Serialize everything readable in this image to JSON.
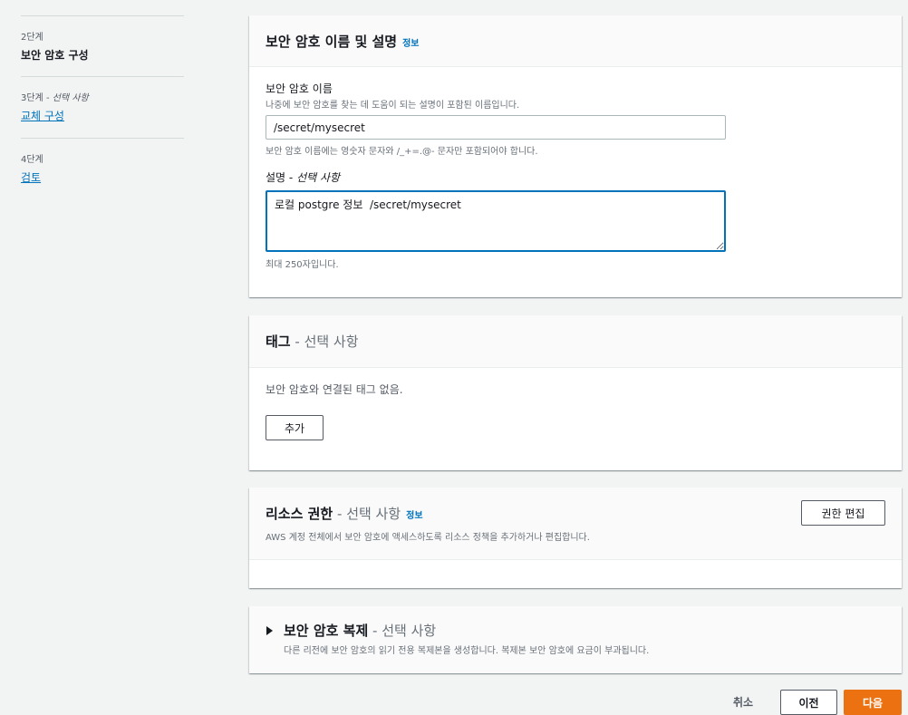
{
  "wizard": {
    "steps": [
      {
        "num": "2단계",
        "label": "보안 암호 구성"
      },
      {
        "num": "3단계",
        "optional": "선택 사항",
        "label": "교체 구성"
      },
      {
        "num": "4단계",
        "label": "검토"
      }
    ],
    "optional_sep": " - "
  },
  "secret_panel": {
    "title": "보안 암호 이름 및 설명",
    "info": "정보",
    "name_label": "보안 암호 이름",
    "name_desc": "나중에 보안 암호를 찾는 데 도움이 되는 설명이 포함된 이름입니다.",
    "name_value": "/secret/mysecret",
    "name_constraint": "보안 암호 이름에는 영숫자 문자와 /_+=.@- 문자만 포함되어야 합니다.",
    "desc_label": "설명",
    "desc_optional": "선택 사항",
    "desc_value": "로컬 postgre 정보  /secret/mysecret",
    "desc_constraint": "최대 250자입니다."
  },
  "tags_panel": {
    "title": "태그",
    "optional": "선택 사항",
    "empty_text": "보안 암호와 연결된 태그 없음.",
    "add_label": "추가"
  },
  "resource_panel": {
    "title": "리소스 권한",
    "optional": "선택 사항",
    "info": "정보",
    "desc": "AWS 계정 전체에서 보안 암호에 액세스하도록 리소스 정책을 추가하거나 편집합니다.",
    "edit_label": "권한 편집"
  },
  "replicate_panel": {
    "title": "보안 암호 복제",
    "optional": "선택 사항",
    "desc": "다른 리전에 보안 암호의 읽기 전용 복제본을 생성합니다. 복제본 보안 암호에 요금이 부과됩니다."
  },
  "footer": {
    "cancel_label": "취소",
    "previous_label": "이전",
    "next_label": "다음"
  }
}
